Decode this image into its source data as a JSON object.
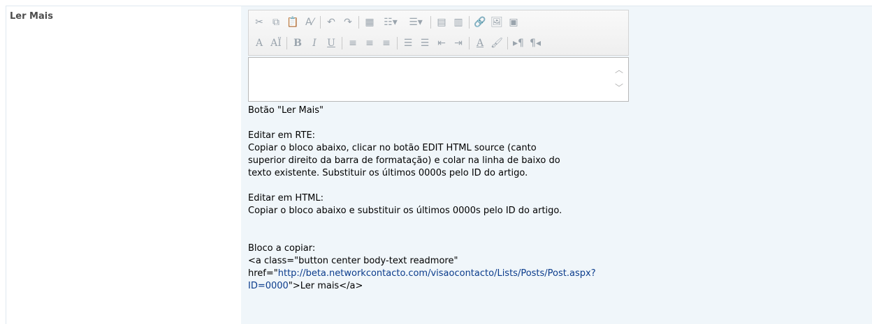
{
  "field": {
    "label": "Ler Mais"
  },
  "toolbar": {
    "row1": [
      {
        "icon": "cut-icon",
        "glyph": "✂"
      },
      {
        "icon": "copy-icon",
        "glyph": "⧉"
      },
      {
        "icon": "paste-icon",
        "glyph": "📋"
      },
      {
        "icon": "spellcheck-icon",
        "glyph": "A⁄"
      },
      {
        "icon": "undo-icon",
        "glyph": "↶"
      },
      {
        "icon": "redo-icon",
        "glyph": "↷"
      },
      {
        "icon": "insert-table-icon",
        "glyph": "▦"
      },
      {
        "icon": "insert-row-icon",
        "glyph": "☷▾"
      },
      {
        "icon": "insert-column-icon",
        "glyph": "☰▾"
      },
      {
        "icon": "merge-cells-icon",
        "glyph": "▤"
      },
      {
        "icon": "table-properties-icon",
        "glyph": "▥"
      },
      {
        "icon": "insert-link-icon",
        "glyph": "🔗"
      },
      {
        "icon": "insert-image-icon",
        "glyph": "🖼"
      },
      {
        "icon": "insert-webpart-icon",
        "glyph": "▣"
      }
    ],
    "row2": [
      {
        "icon": "text-style-icon",
        "glyph": "A"
      },
      {
        "icon": "font-size-icon",
        "glyph": "AÏ"
      },
      {
        "icon": "bold-icon",
        "glyph": "B"
      },
      {
        "icon": "italic-icon",
        "glyph": "I"
      },
      {
        "icon": "underline-icon",
        "glyph": "U"
      },
      {
        "icon": "align-left-icon",
        "glyph": "≡"
      },
      {
        "icon": "align-center-icon",
        "glyph": "≡"
      },
      {
        "icon": "align-right-icon",
        "glyph": "≡"
      },
      {
        "icon": "numbered-list-icon",
        "glyph": "☰"
      },
      {
        "icon": "bullet-list-icon",
        "glyph": "☰"
      },
      {
        "icon": "decrease-indent-icon",
        "glyph": "⇤"
      },
      {
        "icon": "increase-indent-icon",
        "glyph": "⇥"
      },
      {
        "icon": "font-color-icon",
        "glyph": "A"
      },
      {
        "icon": "highlight-color-icon",
        "glyph": "🖌"
      },
      {
        "icon": "ltr-icon",
        "glyph": "▸¶"
      },
      {
        "icon": "rtl-icon",
        "glyph": "¶◂"
      }
    ]
  },
  "description": {
    "line1": "Botão \"Ler Mais\"",
    "line2": "Editar em RTE:",
    "line3": "Copiar o bloco abaixo, clicar no botão EDIT HTML source (canto",
    "line4": "superior direito da barra de formatação) e colar na linha de baixo do",
    "line5": "texto existente. Substituir os últimos 0000s pelo ID do artigo.",
    "line6": "Editar em HTML:",
    "line7": "Copiar o bloco abaixo e substituir os últimos 0000s pelo ID do artigo.",
    "line8": "Bloco a copiar:",
    "line9": "<a class=\"button center body-text readmore\"",
    "line10_prefix": "href=\"",
    "link_part1": "http://beta.networkcontacto.com/visaocontacto/Lists/Posts/Post.aspx?",
    "link_part2": "ID=0000",
    "line11_suffix": "\">Ler mais</a>"
  }
}
